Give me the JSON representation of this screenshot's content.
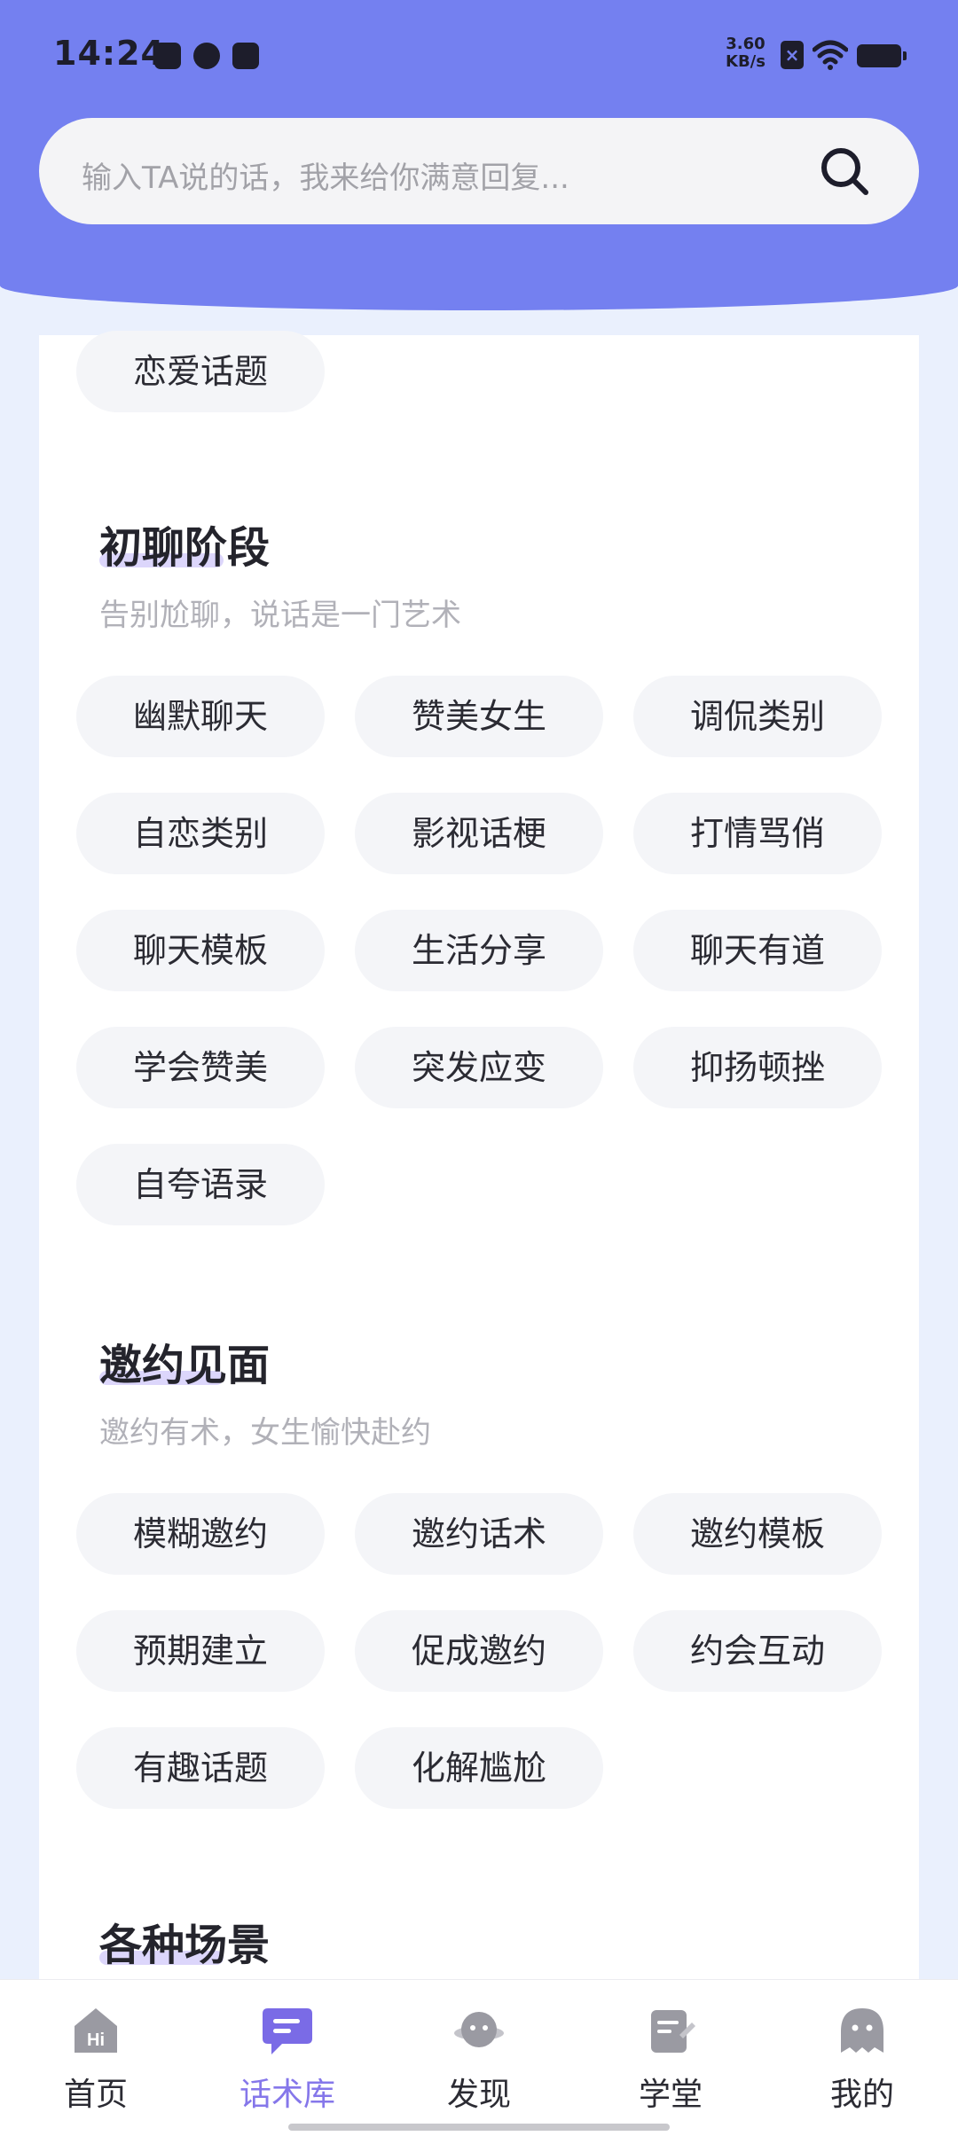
{
  "status_bar": {
    "time": "14:24",
    "speed_value": "3.60",
    "speed_unit": "KB/s"
  },
  "search": {
    "placeholder": "输入TA说的话，我来给你满意回复..."
  },
  "top_chip": "恋爱话题",
  "sections": [
    {
      "title": "初聊阶段",
      "subtitle": "告别尬聊，说话是一门艺术",
      "chips": [
        "幽默聊天",
        "赞美女生",
        "调侃类别",
        "自恋类别",
        "影视话梗",
        "打情骂俏",
        "聊天模板",
        "生活分享",
        "聊天有道",
        "学会赞美",
        "突发应变",
        "抑扬顿挫",
        "自夸语录"
      ]
    },
    {
      "title": "邀约见面",
      "subtitle": "邀约有术，女生愉快赴约",
      "chips": [
        "模糊邀约",
        "邀约话术",
        "邀约模板",
        "预期建立",
        "促成邀约",
        "约会互动",
        "有趣话题",
        "化解尴尬"
      ]
    },
    {
      "title": "各种场景"
    }
  ],
  "nav": [
    {
      "label": "首页",
      "icon": "home-icon"
    },
    {
      "label": "话术库",
      "icon": "chat-library-icon",
      "active": true
    },
    {
      "label": "发现",
      "icon": "discover-icon"
    },
    {
      "label": "学堂",
      "icon": "school-icon"
    },
    {
      "label": "我的",
      "icon": "profile-icon"
    }
  ],
  "colors": {
    "header": "#7480f0",
    "accent": "#8577ea",
    "chip_bg": "#f4f5f8",
    "page_bg": "#eaf0fd"
  }
}
